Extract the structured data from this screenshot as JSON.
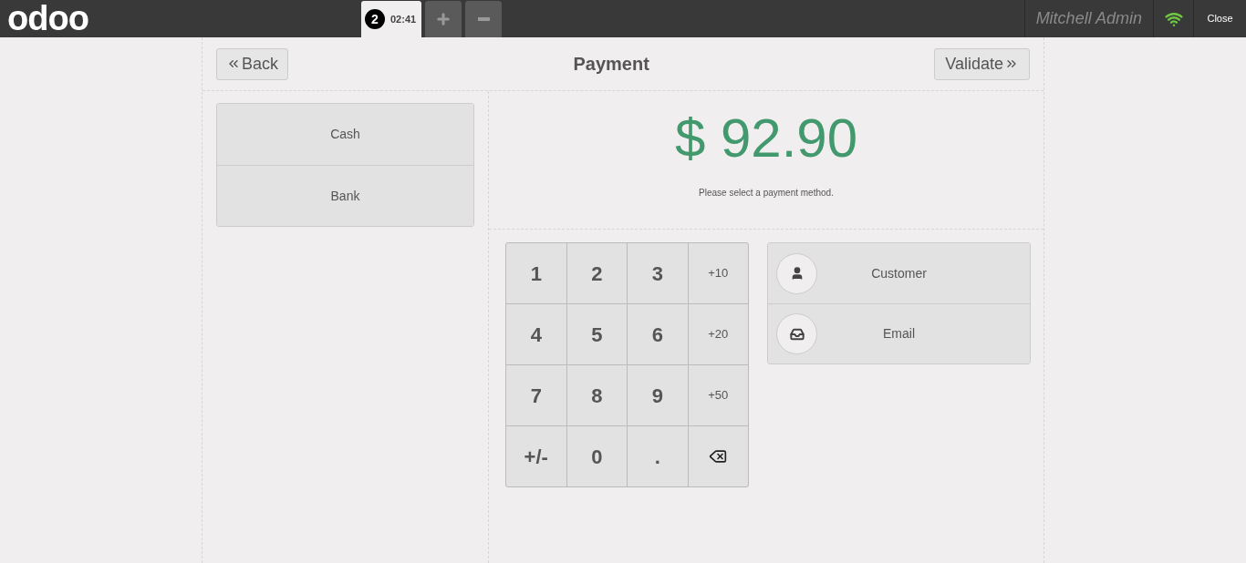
{
  "topbar": {
    "logo": "odoo",
    "orders": [
      {
        "number": "2",
        "time": "02:41",
        "selected": true
      }
    ],
    "user": "Mitchell Admin",
    "close": "Close"
  },
  "header": {
    "back": "Back",
    "title": "Payment",
    "validate": "Validate"
  },
  "payment_methods": [
    "Cash",
    "Bank"
  ],
  "amount": "$ 92.90",
  "message": "Please select a payment method.",
  "keypad": [
    {
      "kind": "digit",
      "label": "1"
    },
    {
      "kind": "digit",
      "label": "2"
    },
    {
      "kind": "digit",
      "label": "3"
    },
    {
      "kind": "small",
      "label": "+10"
    },
    {
      "kind": "digit",
      "label": "4"
    },
    {
      "kind": "digit",
      "label": "5"
    },
    {
      "kind": "digit",
      "label": "6"
    },
    {
      "kind": "small",
      "label": "+20"
    },
    {
      "kind": "digit",
      "label": "7"
    },
    {
      "kind": "digit",
      "label": "8"
    },
    {
      "kind": "digit",
      "label": "9"
    },
    {
      "kind": "small",
      "label": "+50"
    },
    {
      "kind": "digit",
      "label": "+/-"
    },
    {
      "kind": "digit",
      "label": "0"
    },
    {
      "kind": "digit",
      "label": "."
    },
    {
      "kind": "backspace"
    }
  ],
  "actions": [
    {
      "kind": "customer",
      "label": "Customer"
    },
    {
      "kind": "email",
      "label": "Email"
    }
  ]
}
